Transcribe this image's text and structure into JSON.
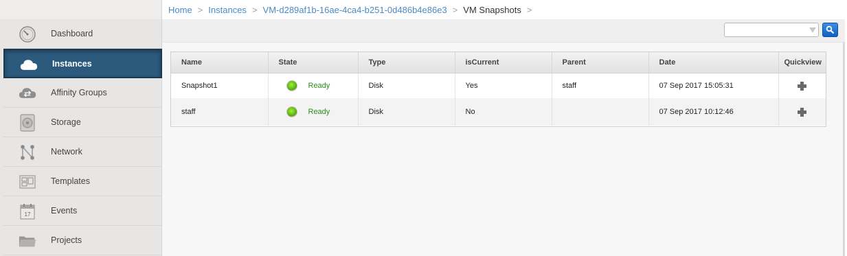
{
  "breadcrumb": {
    "home": "Home",
    "instances": "Instances",
    "vm": "VM-d289af1b-16ae-4ca4-b251-0d486b4e86e3",
    "current": "VM Snapshots",
    "separator": ">"
  },
  "sidebar": {
    "items": [
      {
        "label": "Dashboard",
        "icon": "dashboard-icon"
      },
      {
        "label": "Instances",
        "icon": "cloud-icon",
        "active": true
      },
      {
        "label": "Affinity Groups",
        "icon": "affinity-cloud-icon"
      },
      {
        "label": "Storage",
        "icon": "disk-icon"
      },
      {
        "label": "Network",
        "icon": "network-icon"
      },
      {
        "label": "Templates",
        "icon": "templates-icon"
      },
      {
        "label": "Events",
        "icon": "calendar-icon",
        "badge": "17"
      },
      {
        "label": "Projects",
        "icon": "folder-icon"
      }
    ]
  },
  "search": {
    "value": "",
    "placeholder": ""
  },
  "table": {
    "columns": [
      "Name",
      "State",
      "Type",
      "isCurrent",
      "Parent",
      "Date",
      "Quickview"
    ],
    "rows": [
      {
        "name": "Snapshot1",
        "state": "Ready",
        "type": "Disk",
        "isCurrent": "Yes",
        "parent": "staff",
        "date": "07 Sep 2017 15:05:31"
      },
      {
        "name": "staff",
        "state": "Ready",
        "type": "Disk",
        "isCurrent": "No",
        "parent": "",
        "date": "07 Sep 2017 10:12:46"
      }
    ]
  },
  "colors": {
    "active_nav": "#2c5a7c",
    "link": "#4a8bc6",
    "ready": "#2e8b1a",
    "search_button": "#1260c4"
  }
}
